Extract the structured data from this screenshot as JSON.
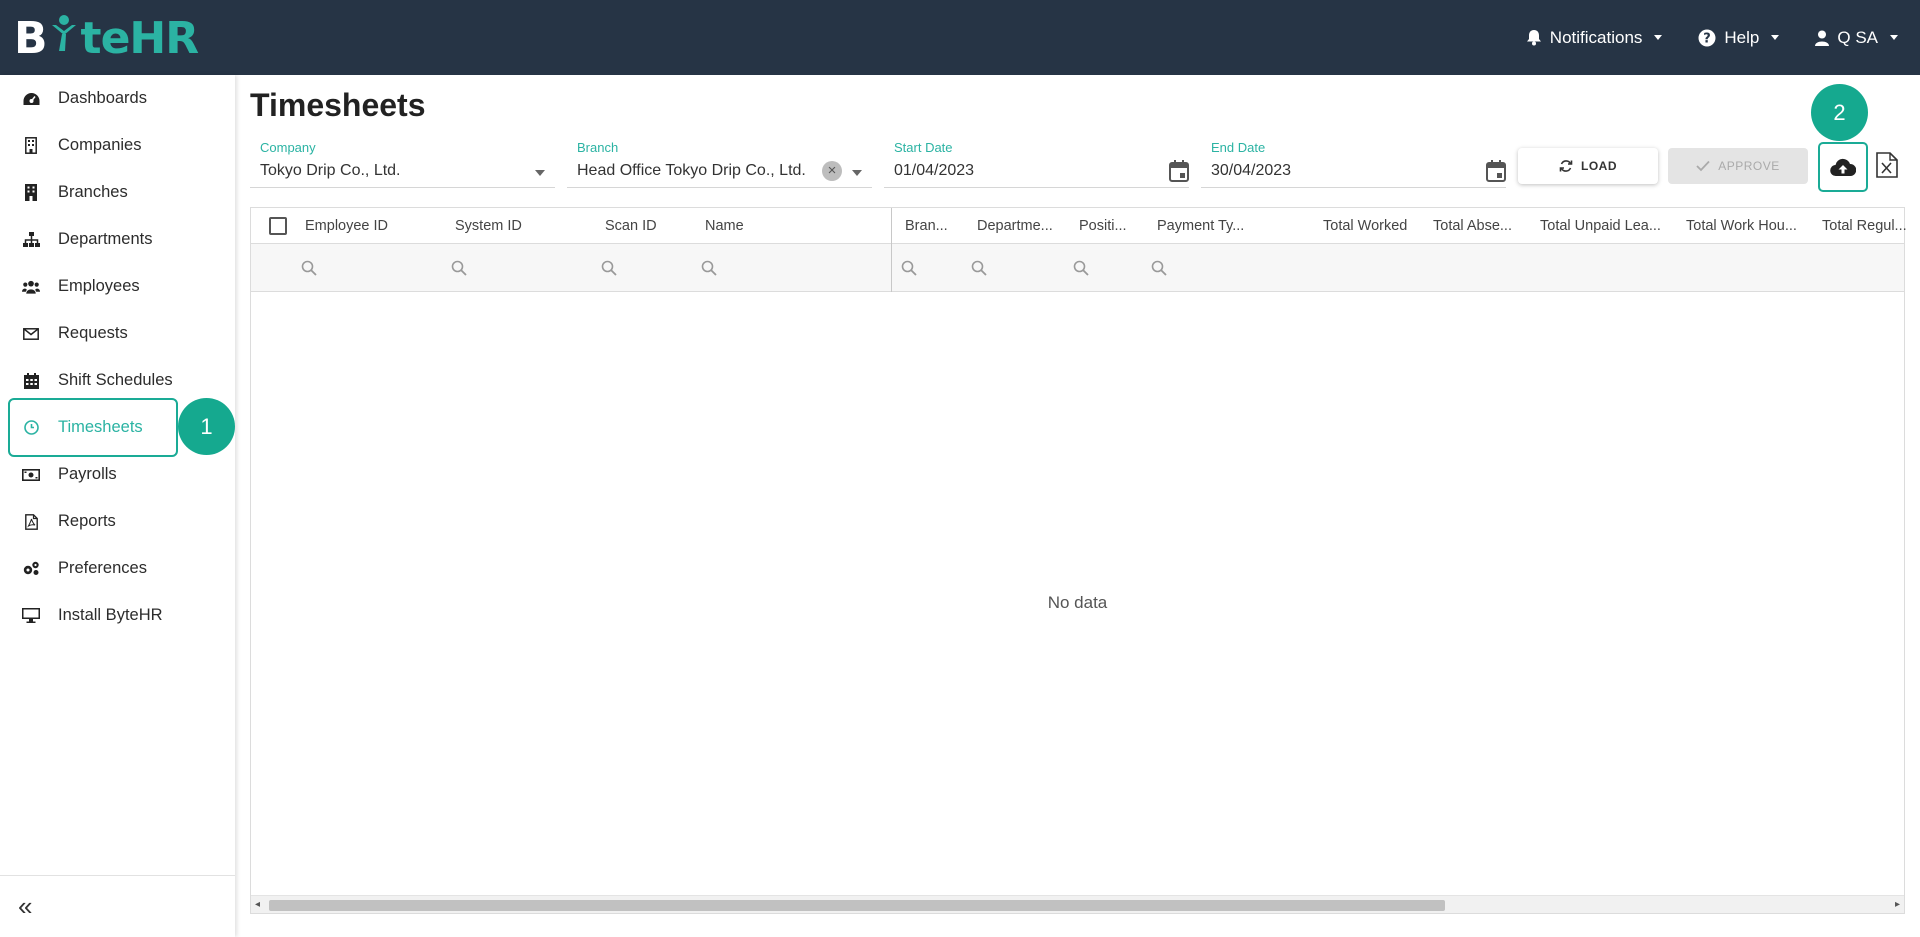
{
  "app": {
    "logo_part1": "B",
    "logo_part2": "te",
    "logo_part3": "HR"
  },
  "topnav": {
    "notifications": "Notifications",
    "help": "Help",
    "user": "Q SA"
  },
  "sidebar": {
    "items": [
      {
        "label": "Dashboards",
        "icon": "dashboard-icon"
      },
      {
        "label": "Companies",
        "icon": "building-icon"
      },
      {
        "label": "Branches",
        "icon": "office-building-icon"
      },
      {
        "label": "Departments",
        "icon": "sitemap-icon"
      },
      {
        "label": "Employees",
        "icon": "users-icon"
      },
      {
        "label": "Requests",
        "icon": "envelope-icon"
      },
      {
        "label": "Shift Schedules",
        "icon": "calendar-icon"
      },
      {
        "label": "Timesheets",
        "icon": "clock-icon"
      },
      {
        "label": "Payrolls",
        "icon": "money-icon"
      },
      {
        "label": "Reports",
        "icon": "pdf-file-icon"
      },
      {
        "label": "Preferences",
        "icon": "gears-icon"
      },
      {
        "label": "Install ByteHR",
        "icon": "desktop-icon"
      }
    ],
    "active": "Timesheets",
    "collapse_label": "«"
  },
  "annotations": {
    "badge1": "1",
    "badge2": "2"
  },
  "page": {
    "title": "Timesheets"
  },
  "filters": {
    "company": {
      "label": "Company",
      "value": "Tokyo Drip Co., Ltd."
    },
    "branch": {
      "label": "Branch",
      "value": "Head Office Tokyo Drip Co., Ltd."
    },
    "start_date": {
      "label": "Start Date",
      "value": "01/04/2023"
    },
    "end_date": {
      "label": "End Date",
      "value": "30/04/2023"
    }
  },
  "buttons": {
    "load": "LOAD",
    "approve": "APPROVE"
  },
  "grid": {
    "columns_left": [
      "Employee ID",
      "System ID",
      "Scan ID",
      "Name"
    ],
    "columns_right": [
      "Bran...",
      "Departme...",
      "Positi...",
      "Payment Ty...",
      "Total Worked",
      "Total Abse...",
      "Total Unpaid Lea...",
      "Total Work Hou...",
      "Total Regul..."
    ],
    "empty_text": "No data"
  },
  "colors": {
    "topbar": "#263445",
    "accent": "#2bb3a3",
    "annotation": "#15a98f"
  }
}
